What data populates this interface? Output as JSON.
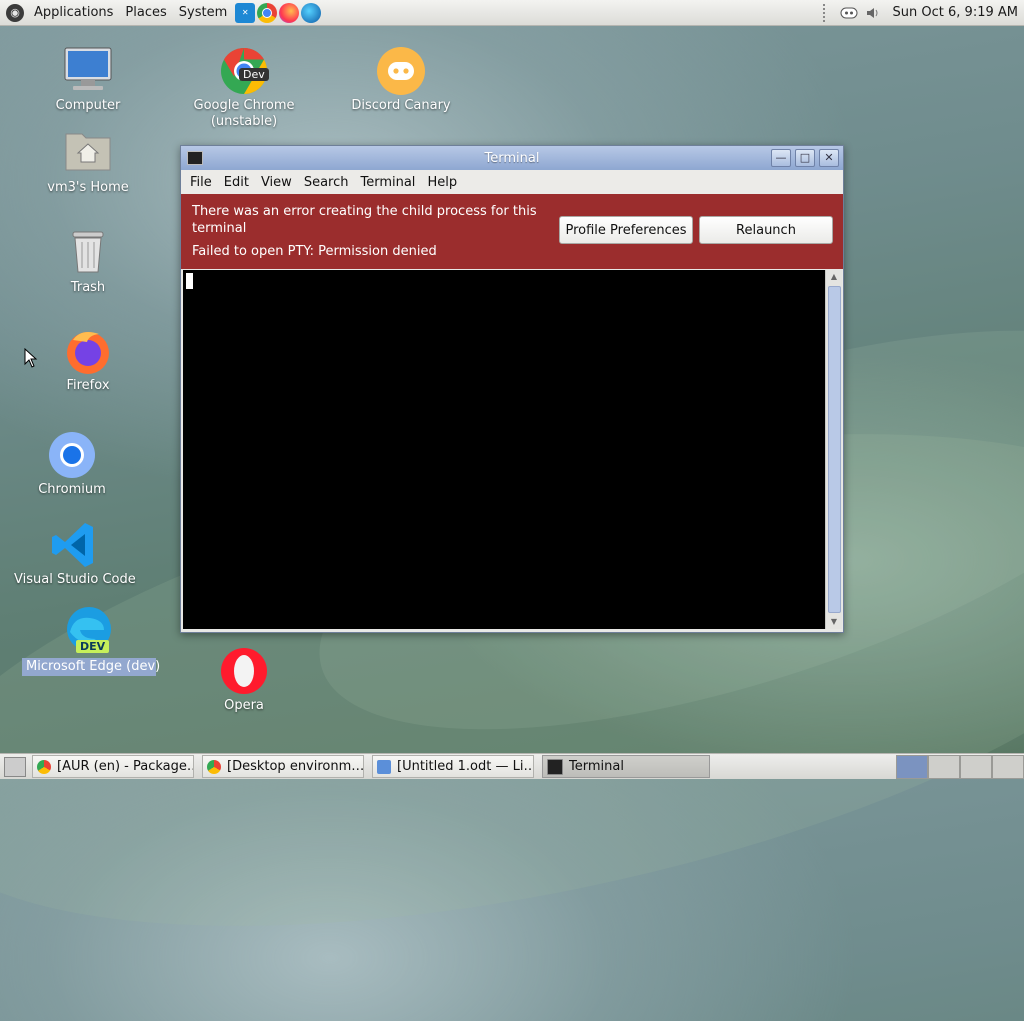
{
  "top_panel": {
    "menus": [
      "Applications",
      "Places",
      "System"
    ],
    "launchers": [
      "vscode-icon",
      "chrome-dev-icon",
      "firefox-icon",
      "edge-dev-icon"
    ],
    "clock": "Sun Oct  6,  9:19 AM"
  },
  "desktop": {
    "icons": [
      {
        "name": "computer",
        "label": "Computer"
      },
      {
        "name": "home",
        "label": "vm3's Home"
      },
      {
        "name": "trash",
        "label": "Trash"
      },
      {
        "name": "firefox",
        "label": "Firefox"
      },
      {
        "name": "chromium",
        "label": "Chromium"
      },
      {
        "name": "vscode",
        "label": "Visual Studio Code"
      },
      {
        "name": "edge-dev",
        "label": "Microsoft Edge (dev)"
      },
      {
        "name": "chrome-dev",
        "label": "Google Chrome\n(unstable)"
      },
      {
        "name": "discord",
        "label": "Discord Canary"
      },
      {
        "name": "opera",
        "label": "Opera"
      }
    ],
    "chrome_badge": "Dev",
    "edge_badge": "DEV"
  },
  "terminal": {
    "title": "Terminal",
    "menu": [
      "File",
      "Edit",
      "View",
      "Search",
      "Terminal",
      "Help"
    ],
    "error_message": "There was an error creating the child process for this terminal",
    "error_detail": "Failed to open PTY: Permission denied",
    "profile_button": "Profile Preferences",
    "relaunch_button": "Relaunch"
  },
  "taskbar": {
    "tasks": [
      {
        "label": "[AUR (en) - Package…",
        "active": false
      },
      {
        "label": "[Desktop environm…",
        "active": false
      },
      {
        "label": "[Untitled 1.odt — Li…",
        "active": false
      },
      {
        "label": "Terminal",
        "active": true
      }
    ]
  }
}
